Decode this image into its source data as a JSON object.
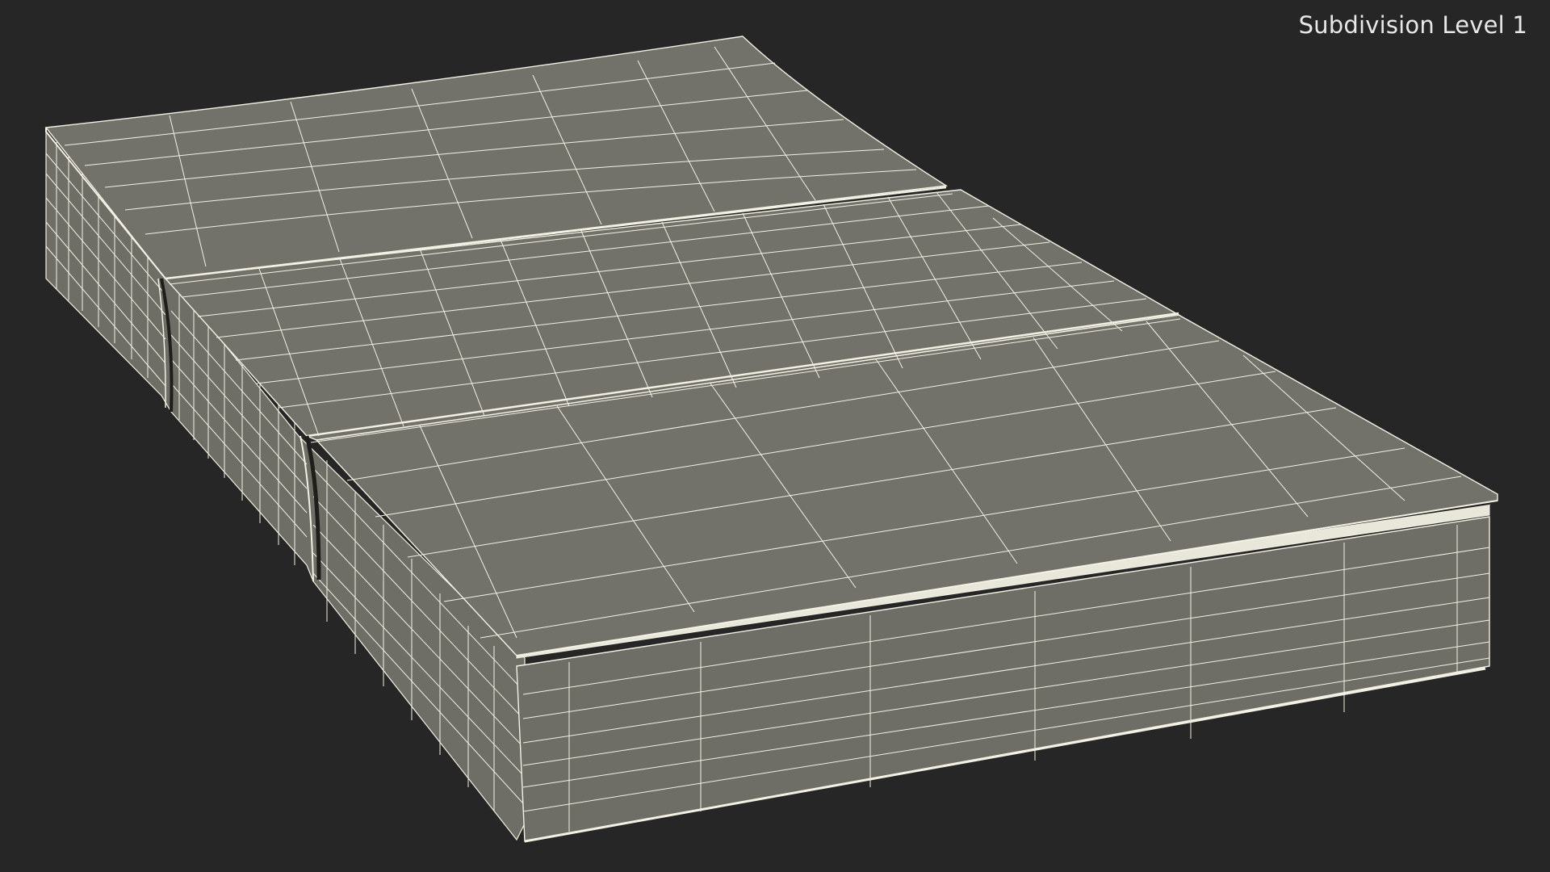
{
  "viewport": {
    "label": "Subdivision Level 1",
    "background_color": "#262626",
    "surface_color": "#72726a",
    "wire_color": "#f3f1e4"
  }
}
